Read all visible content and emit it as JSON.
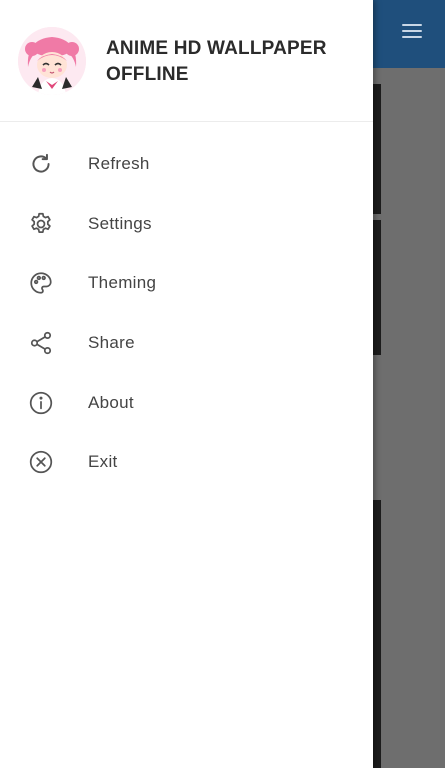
{
  "app": {
    "title": "ANIME HD WALLPAPER OFFLINE"
  },
  "drawer": {
    "items": [
      {
        "label": "Refresh",
        "icon": "refresh-icon"
      },
      {
        "label": "Settings",
        "icon": "gear-icon"
      },
      {
        "label": "Theming",
        "icon": "palette-icon"
      },
      {
        "label": "Share",
        "icon": "share-icon"
      },
      {
        "label": "About",
        "icon": "info-icon"
      },
      {
        "label": "Exit",
        "icon": "close-circle-icon"
      }
    ]
  },
  "colors": {
    "toolbar": "#1f4f7c",
    "scrim": "#6b6b6b",
    "drawer_bg": "#ffffff",
    "text": "#444444"
  }
}
